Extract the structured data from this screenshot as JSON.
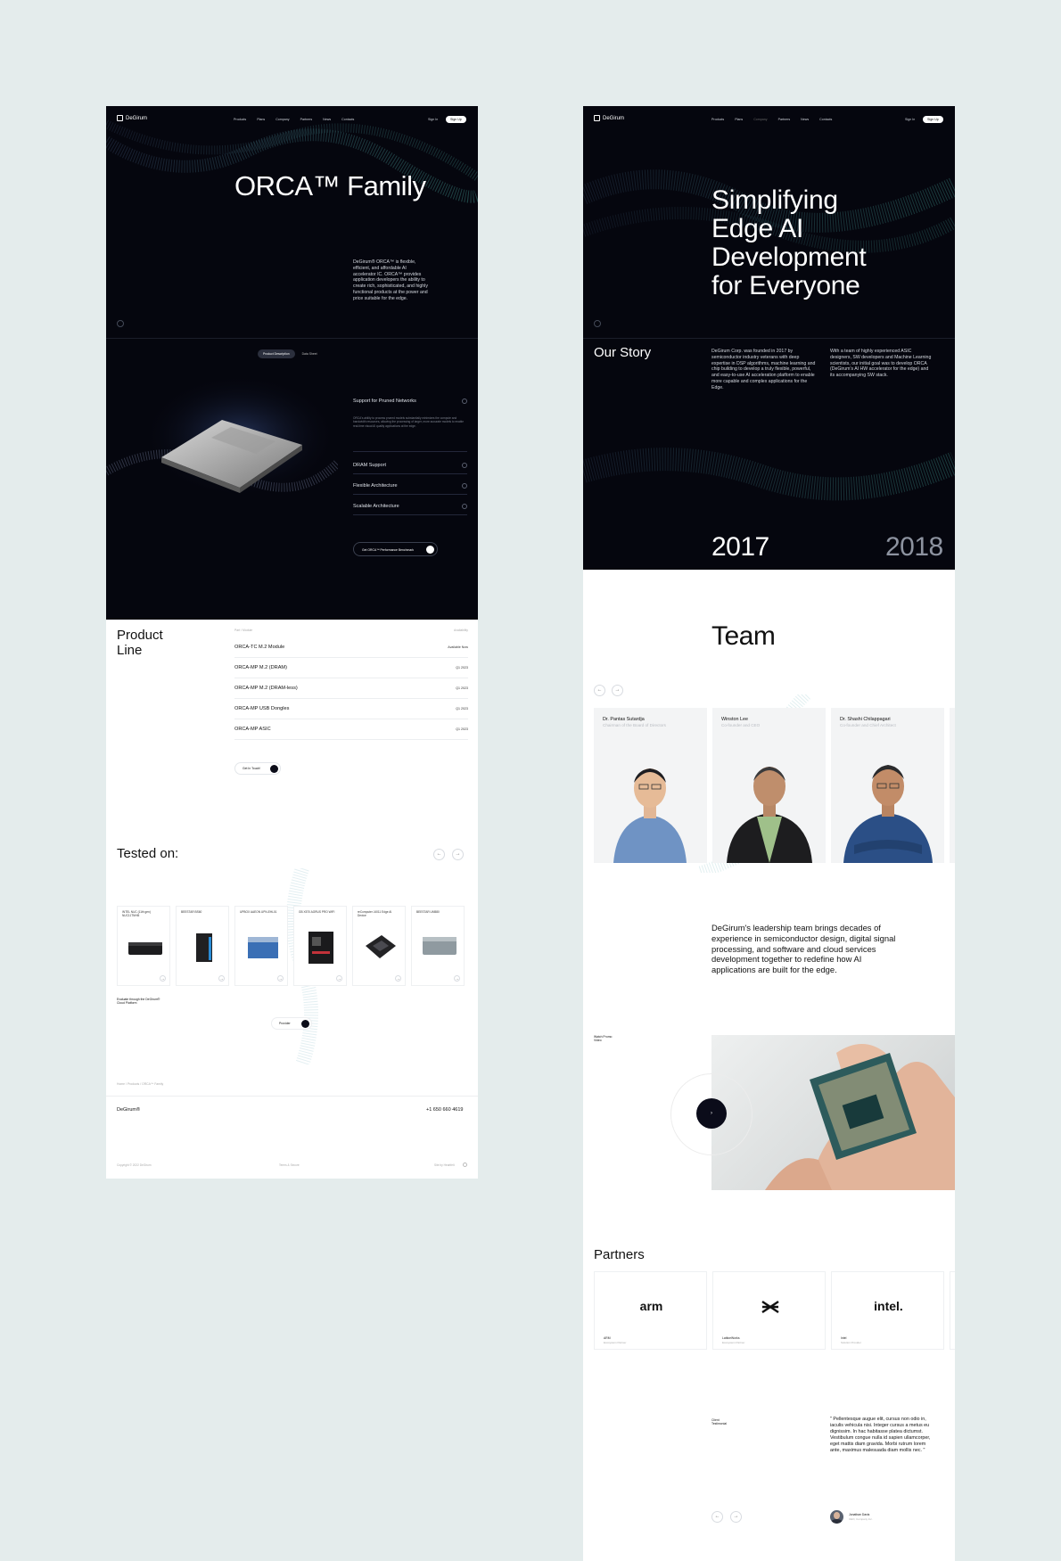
{
  "left": {
    "nav": {
      "logo": "DeGirum",
      "links": [
        "Products",
        "Plans",
        "Company",
        "Partners",
        "News",
        "Contacts"
      ],
      "signin": "Sign In",
      "signup": "Sign Up"
    },
    "hero": {
      "title": "ORCA™ Family",
      "desc": "DeGirum® ORCA™ is flexible, efficient, and affordable AI accelerator IC. ORCA™ provides application developers the ability to create rich, sophisticated, and highly functional products at the power and price suitable for the edge."
    },
    "tabs": {
      "active": "Product Description",
      "other": "Data Sheet"
    },
    "features": [
      {
        "label": "Support for Pruned Networks",
        "desc": "ORCA's ability to process pruned models substantially minimizes the compute and bandwidth resources, allowing the processing of larger, more accurate models to enable real-time visual AI quality applications at the edge."
      },
      {
        "label": "DRAM Support"
      },
      {
        "label": "Flexible Architecture"
      },
      {
        "label": "Scalable Architecture"
      }
    ],
    "cta": "Get ORCA™ Performance Benchmark",
    "product_line": {
      "title_l1": "Product",
      "title_l2": "Line",
      "col_part": "Part / Module",
      "col_avail": "Availability",
      "rows": [
        {
          "name": "ORCA-TC M.2 Module",
          "avail": "Available Now"
        },
        {
          "name": "ORCA-MP M.2 (DRAM)",
          "avail": "Q1 2023"
        },
        {
          "name": "ORCA-MP M.2 (DRAM-less)",
          "avail": "Q1 2023"
        },
        {
          "name": "ORCA-MP USB Dongles",
          "avail": "Q1 2023"
        },
        {
          "name": "ORCA-MP ASIC",
          "avail": "Q1 2023"
        }
      ],
      "contact": "Get In Touch!"
    },
    "tested": {
      "title": "Tested on:",
      "cards": [
        "INTEL NUC (11th gen) NUC11TNHi5",
        "BEESTAR BS60",
        "UPBOX AAEON UPN-EHL01",
        "GB X570 AORUS PRO WIFI",
        "reComputer J4011 Edge AI Device",
        "BEESTAR UM580"
      ],
      "note": "Evaluate through the DeGirum® Cloud Platform",
      "provider": "Provider"
    },
    "breadcrumb": "Home  /  Products  /  ORCA™ Family",
    "footer": {
      "brand": "DeGirum®",
      "phone": "+1 650 660 4619",
      "copy": "Copyright © 2022 DeGirum",
      "terms": "Terms & Secure",
      "made": "Site by Heartfelt"
    }
  },
  "right": {
    "nav": {
      "logo": "DeGirum",
      "links": [
        "Products",
        "Plans",
        "Company",
        "Partners",
        "News",
        "Contacts"
      ],
      "signin": "Sign In",
      "signup": "Sign Up"
    },
    "hero": {
      "title_lines": [
        "Simplifying",
        "Edge AI",
        "Development",
        "for Everyone"
      ]
    },
    "story": {
      "title": "Our Story",
      "col1": "DeGirum Corp. was founded in 2017 by semiconductor industry veterans with deep expertise in DSP algorithms, machine learning and chip building to develop a truly flexible, powerful, and easy-to-use AI acceleration platform to enable more capable and complex applications for the Edge.",
      "col2": "With a team of highly experienced ASIC designers, SW developers and Machine Learning scientists, our initial goal was to develop ORCA (DeGirum's AI HW accelerator for the edge) and its accompanying SW stack.",
      "year1": "2017",
      "year2": "2018"
    },
    "team": {
      "title": "Team",
      "members": [
        {
          "name": "Dr. Pantas Sutardja",
          "role": "Chairman of the Board of Directors"
        },
        {
          "name": "Winston Lee",
          "role": "Co-founder and CEO"
        },
        {
          "name": "Dr. Shashi Chilappagari",
          "role": "Co-founder and Chief Architect"
        }
      ],
      "desc": "DeGirum's leadership team brings decades of experience in semiconductor design, digital signal processing, and software and cloud services development together to redefine how AI applications are built for the edge."
    },
    "video": {
      "label_l1": "Watch Promo",
      "label_l2": "Video"
    },
    "partners": {
      "title": "Partners",
      "items": [
        {
          "logo": "arm",
          "name": "ARM",
          "role": "Ecosystem Partner"
        },
        {
          "logo": "",
          "name": "LatticeWorks",
          "role": "Ecosystem Partner"
        },
        {
          "logo": "intel.",
          "name": "Intel",
          "role": "Solution Provider"
        }
      ]
    },
    "testimonial": {
      "label_l1": "Client",
      "label_l2": "Testimonial",
      "quote": "\" Pellentesque augue elit, cursus non odio in, iaculis vehicula nisi. Integer cursus a metus eu dignissim. In hac habitasse platea dictumst. Vestibulum congue nulla id sapien ullamcorper, eget mattis diam gravida. Morbi rutrum lorem ante, maximus malesuada diam mollis nec. \"",
      "name": "Jonathan Davis",
      "role": "CEO, Company Inc."
    }
  }
}
